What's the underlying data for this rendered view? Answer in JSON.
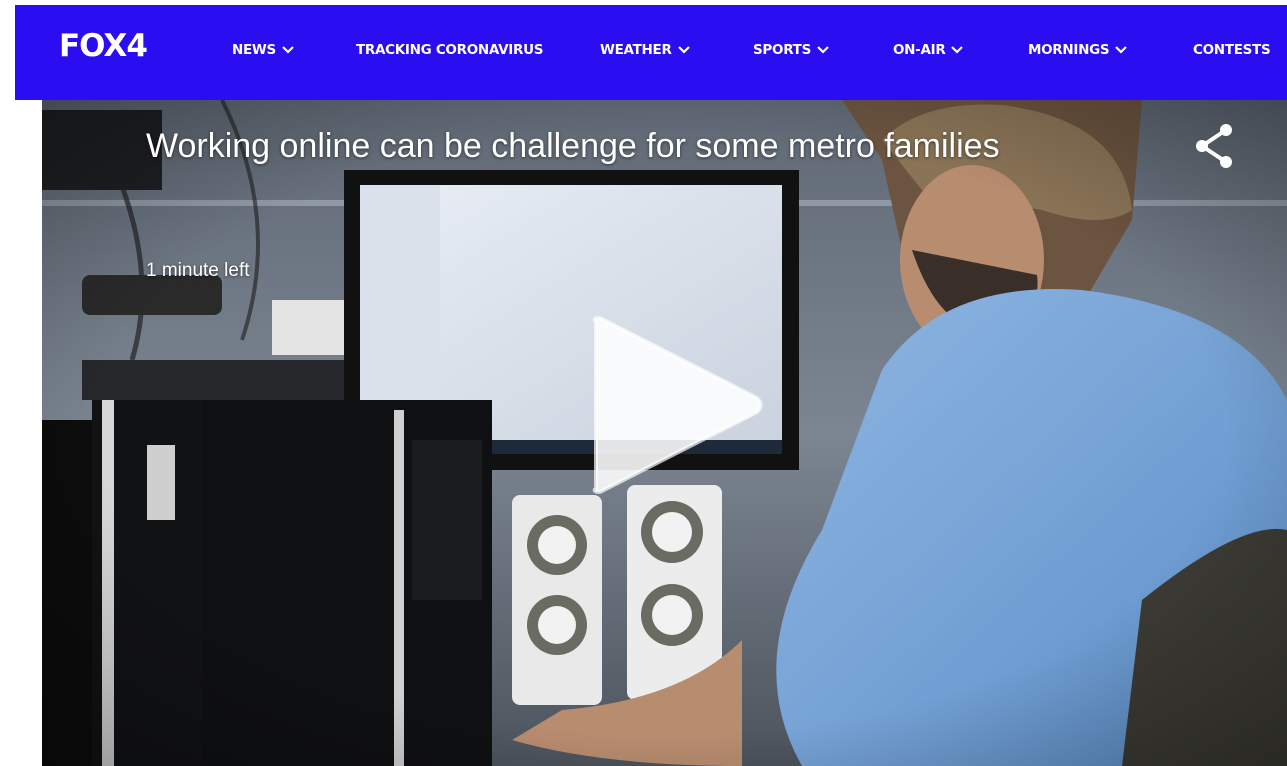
{
  "header": {
    "logo": "FOX4",
    "nav": [
      {
        "label": "NEWS",
        "has_dropdown": true
      },
      {
        "label": "TRACKING CORONAVIRUS",
        "has_dropdown": false
      },
      {
        "label": "WEATHER",
        "has_dropdown": true
      },
      {
        "label": "SPORTS",
        "has_dropdown": true
      },
      {
        "label": "ON-AIR",
        "has_dropdown": true
      },
      {
        "label": "MORNINGS",
        "has_dropdown": true
      },
      {
        "label": "CONTESTS",
        "has_dropdown": false
      }
    ]
  },
  "video": {
    "title": "Working online can be challenge for some metro families",
    "time_left": "1 minute left",
    "play_icon": "play-icon",
    "share_icon": "share-icon"
  },
  "colors": {
    "nav_background": "#2a0df0",
    "text": "#ffffff"
  }
}
